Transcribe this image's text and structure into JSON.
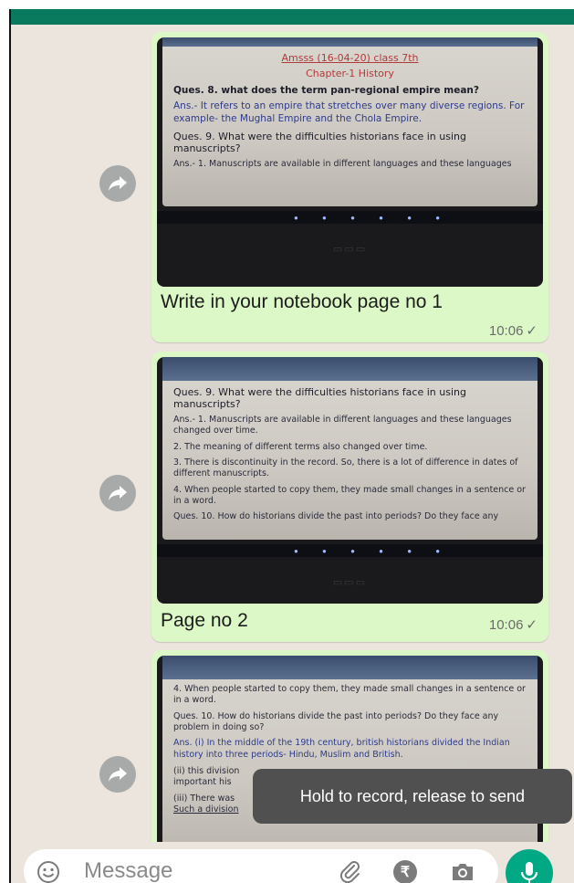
{
  "messages": [
    {
      "caption": "Write in your notebook page no 1",
      "time": "10:06",
      "image_text": {
        "header1": "Amsss (16-04-20) class 7th",
        "header2": "Chapter-1 History",
        "q8": "Ques. 8. what does the term pan-regional empire mean?",
        "a8": "Ans.- It refers to an empire that stretches over many diverse regions. For example- the Mughal Empire and the Chola Empire.",
        "q9": "Ques. 9. What were the difficulties historians face in using manuscripts?",
        "a9_1": "Ans.- 1. Manuscripts are available in different languages and these languages"
      }
    },
    {
      "caption": "Page no 2",
      "time": "10:06",
      "image_text": {
        "q9": "Ques. 9. What were the difficulties historians face in using manuscripts?",
        "a9_1": "Ans.- 1. Manuscripts are available in different languages and these languages changed over time.",
        "a9_2": "2. The meaning of different terms also changed over time.",
        "a9_3": "3. There is discontinuity in the record. So, there is a lot of difference in dates of different manuscripts.",
        "a9_4": "4. When people started to copy them, they made small changes in a sentence or in a word.",
        "q10_partial": "Ques. 10. How do historians divide the past into periods? Do they face any"
      }
    },
    {
      "image_text": {
        "a9_4": "4. When people started to copy them, they made small changes in a sentence or in a word.",
        "q10": "Ques. 10. How do historians divide the past into periods? Do they face any problem in doing so?",
        "a10": "Ans. (i) In the middle of the 19th century, british historians divided the Indian history into three periods- Hindu, Muslim and British.",
        "a10_ii": "(ii) this division",
        "a10_ii_b": "important his",
        "a10_iii": "(iii) There was",
        "a10_iii_b": "Such a division"
      }
    }
  ],
  "tooltip": "Hold to record, release to send",
  "composer": {
    "placeholder": "Message"
  },
  "colors": {
    "header": "#0a7a5e",
    "bubble": "#dcf8c6",
    "mic": "#00a884",
    "background": "#ece5dd"
  },
  "icons": [
    "forward-icon",
    "emoji-icon",
    "attach-icon",
    "rupee-icon",
    "camera-icon",
    "mic-icon",
    "double-tick-icon"
  ]
}
